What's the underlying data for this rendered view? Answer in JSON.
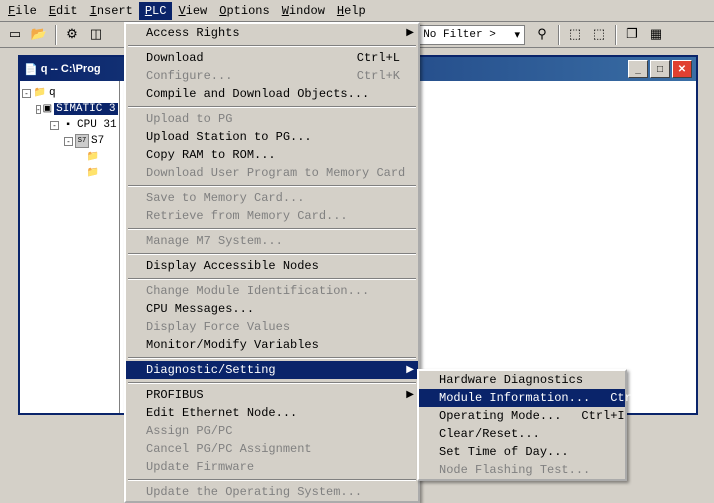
{
  "menubar": {
    "file": "File",
    "edit": "Edit",
    "insert": "Insert",
    "plc": "PLC",
    "view": "View",
    "options": "Options",
    "window": "Window",
    "help": "Help"
  },
  "toolbar": {
    "filter": "< No Filter >"
  },
  "childwin": {
    "title": "q -- C:\\Prog"
  },
  "tree": {
    "root": "q",
    "s1": "SIMATIC 3",
    "cpu": "CPU 31",
    "s7": "S7"
  },
  "plc_menu": {
    "access_rights": "Access Rights",
    "download": "Download",
    "download_sc": "Ctrl+L",
    "configure": "Configure...",
    "configure_sc": "Ctrl+K",
    "compile": "Compile and Download Objects...",
    "upload_pg": "Upload to PG",
    "upload_station": "Upload Station to PG...",
    "copy_ram": "Copy RAM to ROM...",
    "dl_user_prog": "Download User Program to Memory Card",
    "save_mc": "Save to Memory Card...",
    "retrieve_mc": "Retrieve from Memory Card...",
    "manage_m7": "Manage M7 System...",
    "disp_nodes": "Display Accessible Nodes",
    "change_mod": "Change Module Identification...",
    "cpu_msgs": "CPU Messages...",
    "disp_force": "Display Force Values",
    "mon_mod": "Monitor/Modify Variables",
    "diag": "Diagnostic/Setting",
    "profibus": "PROFIBUS",
    "edit_eth": "Edit Ethernet Node...",
    "assign_pgpc": "Assign PG/PC",
    "cancel_pgpc": "Cancel PG/PC Assignment",
    "update_fw": "Update Firmware",
    "update_os": "Update the Operating System..."
  },
  "diag_sub": {
    "hw_diag": "Hardware Diagnostics",
    "mod_info": "Module Information...",
    "mod_info_sc": "Ctrl+D",
    "op_mode": "Operating Mode...",
    "op_mode_sc": "Ctrl+I",
    "clear": "Clear/Reset...",
    "set_time": "Set Time of Day...",
    "node_flash": "Node Flashing Test..."
  }
}
